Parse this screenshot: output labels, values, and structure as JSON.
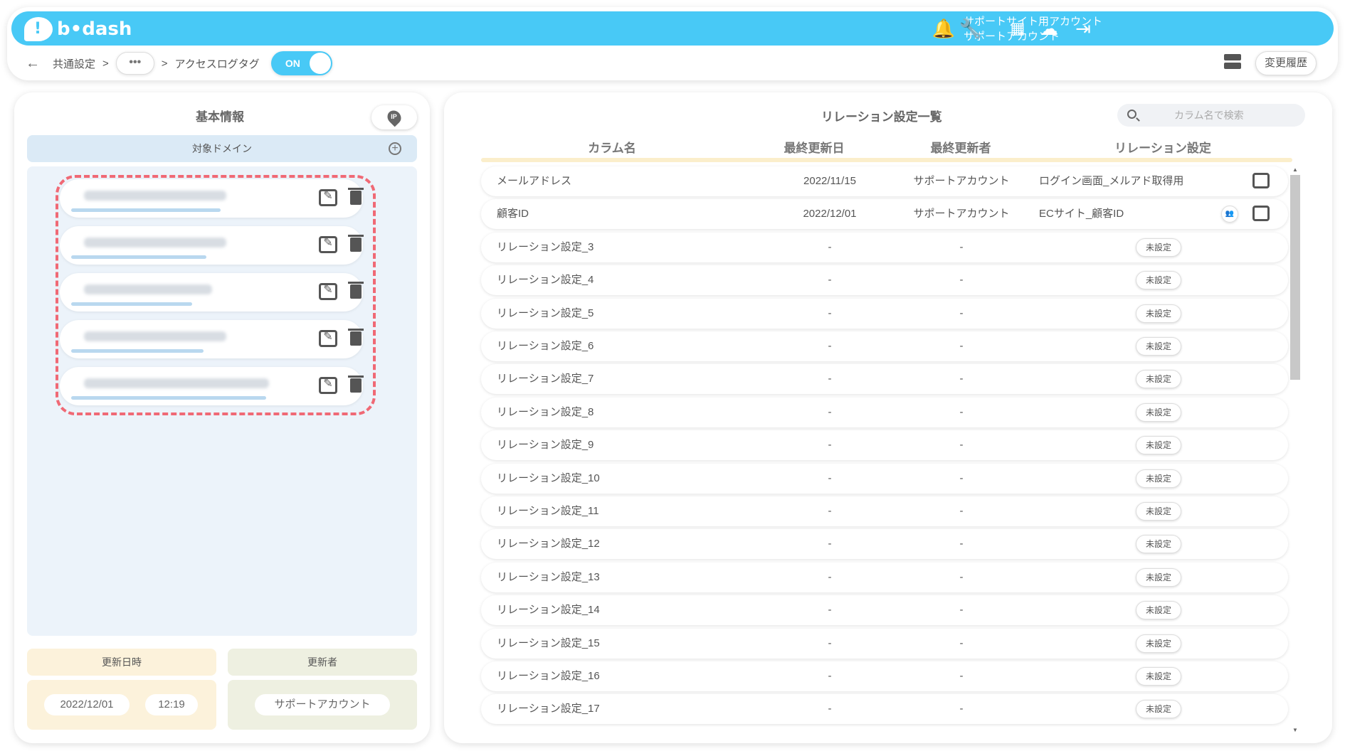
{
  "header": {
    "logo": "b•dash",
    "account_line1": "サポートサイト用アカウント",
    "account_line2": "サポートアカウント",
    "icons": [
      "bell-icon",
      "wrench-icon",
      "apps-grid-icon",
      "chat-bot-icon",
      "logout-icon"
    ]
  },
  "breadcrumb": {
    "back": "←",
    "item1": "共通設定",
    "sep": ">",
    "ellipsis": "•••",
    "current": "アクセスログタグ"
  },
  "toggle": {
    "label": "ON",
    "state": "on"
  },
  "history_button": "変更履歴",
  "left": {
    "title": "基本情報",
    "domain_header": "対象ドメイン",
    "domains": [
      "",
      "",
      "",
      "",
      ""
    ],
    "updated_label": "更新日時",
    "updater_label": "更新者",
    "date": "2022/12/01",
    "time": "12:19",
    "updater": "サポートアカウント"
  },
  "right": {
    "title": "リレーション設定一覧",
    "search_placeholder": "カラム名で検索",
    "columns": [
      "カラム名",
      "最終更新日",
      "最終更新者",
      "リレーション設定"
    ],
    "unset_label": "未設定",
    "rows": [
      {
        "name": "メールアドレス",
        "date": "2022/11/15",
        "user": "サポートアカウント",
        "relation": "ログイン画面_メルアド取得用",
        "set": true
      },
      {
        "name": "顧客ID",
        "date": "2022/12/01",
        "user": "サポートアカウント",
        "relation": "ECサイト_顧客ID",
        "set": true
      },
      {
        "name": "リレーション設定_3",
        "date": "-",
        "user": "-",
        "relation": "",
        "set": false
      },
      {
        "name": "リレーション設定_4",
        "date": "-",
        "user": "-",
        "relation": "",
        "set": false
      },
      {
        "name": "リレーション設定_5",
        "date": "-",
        "user": "-",
        "relation": "",
        "set": false
      },
      {
        "name": "リレーション設定_6",
        "date": "-",
        "user": "-",
        "relation": "",
        "set": false
      },
      {
        "name": "リレーション設定_7",
        "date": "-",
        "user": "-",
        "relation": "",
        "set": false
      },
      {
        "name": "リレーション設定_8",
        "date": "-",
        "user": "-",
        "relation": "",
        "set": false
      },
      {
        "name": "リレーション設定_9",
        "date": "-",
        "user": "-",
        "relation": "",
        "set": false
      },
      {
        "name": "リレーション設定_10",
        "date": "-",
        "user": "-",
        "relation": "",
        "set": false
      },
      {
        "name": "リレーション設定_11",
        "date": "-",
        "user": "-",
        "relation": "",
        "set": false
      },
      {
        "name": "リレーション設定_12",
        "date": "-",
        "user": "-",
        "relation": "",
        "set": false
      },
      {
        "name": "リレーション設定_13",
        "date": "-",
        "user": "-",
        "relation": "",
        "set": false
      },
      {
        "name": "リレーション設定_14",
        "date": "-",
        "user": "-",
        "relation": "",
        "set": false
      },
      {
        "name": "リレーション設定_15",
        "date": "-",
        "user": "-",
        "relation": "",
        "set": false
      },
      {
        "name": "リレーション設定_16",
        "date": "-",
        "user": "-",
        "relation": "",
        "set": false
      },
      {
        "name": "リレーション設定_17",
        "date": "-",
        "user": "-",
        "relation": "",
        "set": false
      }
    ]
  },
  "colors": {
    "accent": "#48c9f6",
    "danger_dash": "#f06975",
    "panel_blue": "#ecf3fa",
    "date_bg": "#fcf2db",
    "user_bg": "#eef0e1"
  }
}
